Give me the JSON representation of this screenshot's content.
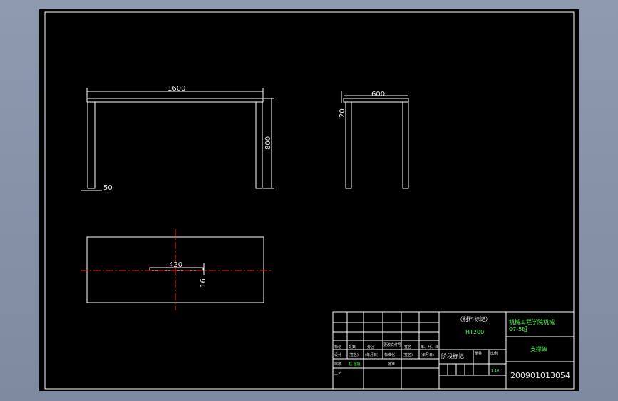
{
  "drawing": {
    "front_view": {
      "width_dim": "1600",
      "height_dim": "800",
      "leg_dim": "50"
    },
    "side_view": {
      "width_dim": "600",
      "top_dim": "20"
    },
    "plan_view": {
      "slot_length_dim": "420",
      "slot_width_dim": "16"
    }
  },
  "title_block": {
    "material_mark": "（材料标记）",
    "material": "HT200",
    "school_line1": "机械工程学院机械",
    "school_line2": "07-5班",
    "part_name": "支撑架",
    "drawing_number": "200901013054",
    "stage_mark": "阶段标记",
    "weight_label": "重量",
    "scale_label": "比例",
    "scale_value": "1:10",
    "rev_headers": [
      "标记",
      "处数",
      "分区",
      "更改文件号",
      "签名",
      "年、月、日"
    ],
    "design_row": [
      "设计",
      "(签名)",
      "(年月日)",
      "标准化",
      "(签名)",
      "(年月日)"
    ],
    "small_labels": {
      "check": "审核",
      "process": "工艺",
      "approve": "批准",
      "reviewer": "赵 国良"
    }
  },
  "colors": {
    "sheet": "#000000",
    "outline": "#ffffff",
    "centerline": "#ff2222",
    "title_text": "#4cff4c"
  }
}
